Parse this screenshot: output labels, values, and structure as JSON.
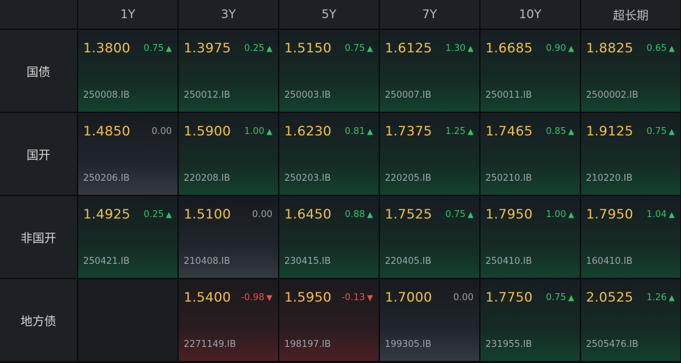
{
  "headers": [
    "1Y",
    "3Y",
    "5Y",
    "7Y",
    "10Y",
    "超长期"
  ],
  "rows": [
    {
      "label": "国债",
      "cells": [
        {
          "price": "1.3800",
          "change": "0.75",
          "dir": "up",
          "arrow": "▲",
          "code": "250008.IB"
        },
        {
          "price": "1.3975",
          "change": "0.25",
          "dir": "up",
          "arrow": "▲",
          "code": "250012.IB"
        },
        {
          "price": "1.5150",
          "change": "0.75",
          "dir": "up",
          "arrow": "▲",
          "code": "250003.IB"
        },
        {
          "price": "1.6125",
          "change": "1.30",
          "dir": "up",
          "arrow": "▲",
          "code": "250007.IB"
        },
        {
          "price": "1.6685",
          "change": "0.90",
          "dir": "up",
          "arrow": "▲",
          "code": "250011.IB"
        },
        {
          "price": "1.8825",
          "change": "0.65",
          "dir": "up",
          "arrow": "▲",
          "code": "2500002.IB"
        }
      ]
    },
    {
      "label": "国开",
      "cells": [
        {
          "price": "1.4850",
          "change": "0.00",
          "dir": "flat",
          "arrow": "",
          "code": "250206.IB"
        },
        {
          "price": "1.5900",
          "change": "1.00",
          "dir": "up",
          "arrow": "▲",
          "code": "220208.IB"
        },
        {
          "price": "1.6230",
          "change": "0.81",
          "dir": "up",
          "arrow": "▲",
          "code": "250203.IB"
        },
        {
          "price": "1.7375",
          "change": "1.25",
          "dir": "up",
          "arrow": "▲",
          "code": "220205.IB"
        },
        {
          "price": "1.7465",
          "change": "0.85",
          "dir": "up",
          "arrow": "▲",
          "code": "250210.IB"
        },
        {
          "price": "1.9125",
          "change": "0.75",
          "dir": "up",
          "arrow": "▲",
          "code": "210220.IB"
        }
      ]
    },
    {
      "label": "非国开",
      "cells": [
        {
          "price": "1.4925",
          "change": "0.25",
          "dir": "up",
          "arrow": "▲",
          "code": "250421.IB"
        },
        {
          "price": "1.5100",
          "change": "0.00",
          "dir": "flat",
          "arrow": "",
          "code": "210408.IB"
        },
        {
          "price": "1.6450",
          "change": "0.88",
          "dir": "up",
          "arrow": "▲",
          "code": "230415.IB"
        },
        {
          "price": "1.7525",
          "change": "0.75",
          "dir": "up",
          "arrow": "▲",
          "code": "220405.IB"
        },
        {
          "price": "1.7950",
          "change": "1.00",
          "dir": "up",
          "arrow": "▲",
          "code": "250410.IB"
        },
        {
          "price": "1.7950",
          "change": "1.04",
          "dir": "up",
          "arrow": "▲",
          "code": "160410.IB"
        }
      ]
    },
    {
      "label": "地方债",
      "cells": [
        null,
        {
          "price": "1.5400",
          "change": "-0.98",
          "dir": "down",
          "arrow": "▼",
          "code": "2271149.IB"
        },
        {
          "price": "1.5950",
          "change": "-0.13",
          "dir": "down",
          "arrow": "▼",
          "code": "198197.IB"
        },
        {
          "price": "1.7000",
          "change": "0.00",
          "dir": "flat",
          "arrow": "",
          "code": "199305.IB"
        },
        {
          "price": "1.7750",
          "change": "0.75",
          "dir": "up",
          "arrow": "▲",
          "code": "231955.IB"
        },
        {
          "price": "2.0525",
          "change": "1.26",
          "dir": "up",
          "arrow": "▲",
          "code": "2505476.IB"
        }
      ]
    }
  ],
  "colors": {
    "price": "#f4c046",
    "up": "#2fc36a",
    "down": "#ee4b4b",
    "flat": "#9aa0a6"
  }
}
